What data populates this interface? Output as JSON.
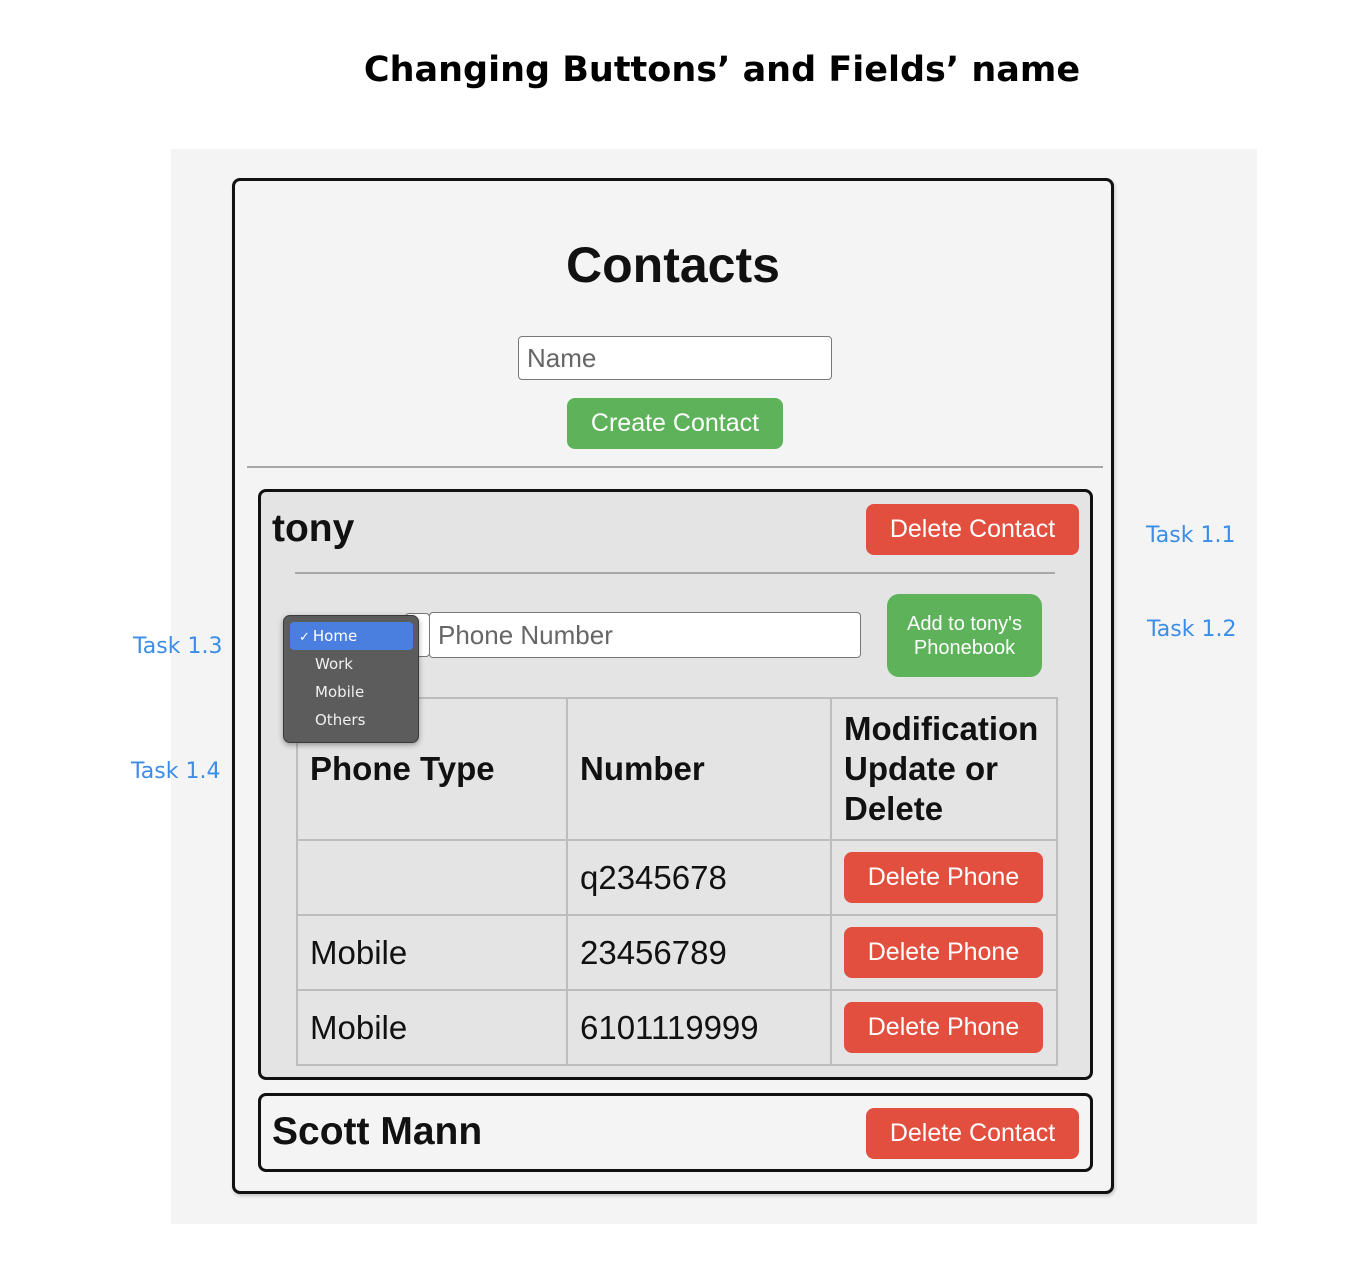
{
  "heading": "Changing Buttons’ and Fields’ name",
  "app": {
    "title": "Contacts",
    "name_placeholder": "Name",
    "create_label": "Create Contact"
  },
  "contacts": [
    {
      "name": "tony",
      "delete_label": "Delete Contact",
      "phone_placeholder": "Phone Number",
      "add_label": "Add to tony's\nPhonebook",
      "dropdown": {
        "selected": "Home",
        "options": [
          "Home",
          "Work",
          "Mobile",
          "Others"
        ]
      },
      "table": {
        "headers": [
          "Phone Type",
          "Number",
          "Modification Update or Delete"
        ],
        "rows": [
          {
            "type": "",
            "number": "q2345678",
            "action": "Delete Phone"
          },
          {
            "type": "Mobile",
            "number": "23456789",
            "action": "Delete Phone"
          },
          {
            "type": "Mobile",
            "number": "6101119999",
            "action": "Delete Phone"
          }
        ]
      }
    },
    {
      "name": "Scott Mann",
      "delete_label": "Delete Contact"
    }
  ],
  "tasks": {
    "t11": "Task 1.1",
    "t12": "Task 1.2",
    "t13": "Task 1.3",
    "t14": "Task 1.4"
  },
  "colors": {
    "green": "#5db25a",
    "red": "#e34f3f",
    "task_blue": "#3b8de8",
    "dropdown_selected": "#4a7fe0"
  }
}
